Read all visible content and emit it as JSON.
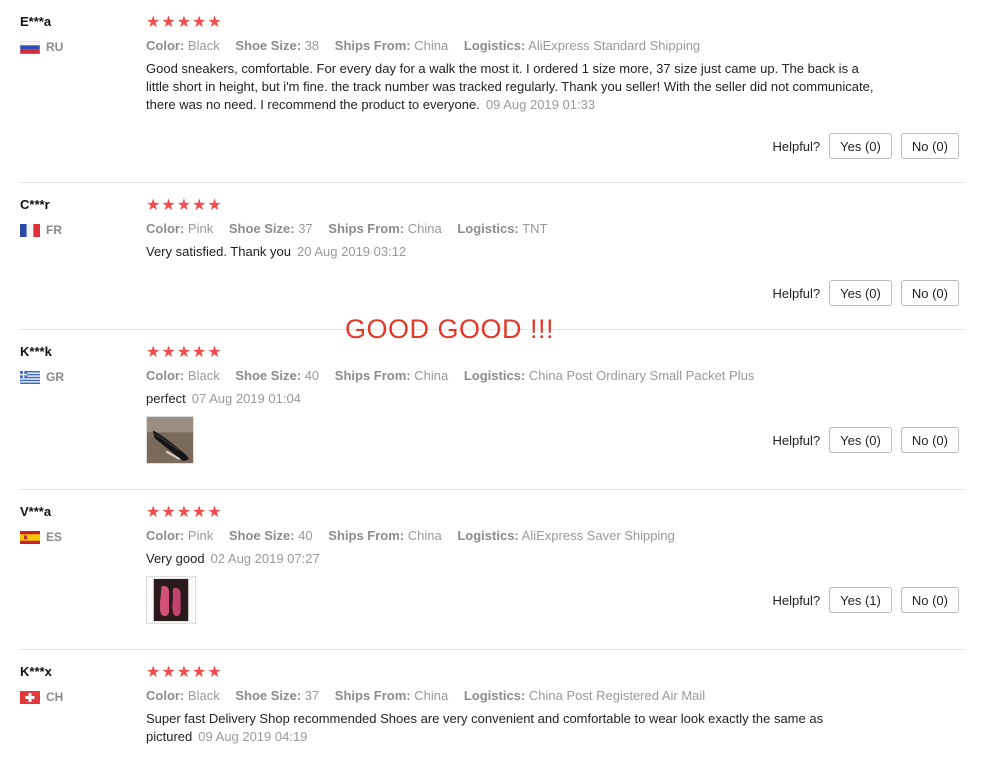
{
  "helpful_label": "Helpful?",
  "banner": "GOOD GOOD !!!",
  "colors": {
    "star": "#f04d4d",
    "banner": "#e23a2a",
    "meta": "#999999"
  },
  "reviews": [
    {
      "user": "E***a",
      "country": "RU",
      "stars": "★★★★★",
      "color_label": "Color:",
      "color": "Black",
      "size_label": "Shoe Size:",
      "size": "38",
      "ships_label": "Ships From:",
      "ships": "China",
      "logistics_label": "Logistics:",
      "logistics": "AliExpress Standard Shipping",
      "text": "Good sneakers, comfortable. For every day for a walk the most it. I ordered 1 size more, 37 size just came up. The back is a little short in height, but i'm fine. the track number was tracked regularly. Thank you seller! With the seller did not communicate, there was no need. I recommend the product to everyone.",
      "date": "09 Aug 2019 01:33",
      "yes": "Yes (0)",
      "no": "No (0)"
    },
    {
      "user": "C***r",
      "country": "FR",
      "stars": "★★★★★",
      "color_label": "Color:",
      "color": "Pink",
      "size_label": "Shoe Size:",
      "size": "37",
      "ships_label": "Ships From:",
      "ships": "China",
      "logistics_label": "Logistics:",
      "logistics": "TNT",
      "text": "Very satisfied. Thank you",
      "date": "20 Aug 2019 03:12",
      "yes": "Yes (0)",
      "no": "No (0)"
    },
    {
      "user": "K***k",
      "country": "GR",
      "stars": "★★★★★",
      "color_label": "Color:",
      "color": "Black",
      "size_label": "Shoe Size:",
      "size": "40",
      "ships_label": "Ships From:",
      "ships": "China",
      "logistics_label": "Logistics:",
      "logistics": "China Post Ordinary Small Packet Plus",
      "text": "perfect",
      "date": "07 Aug 2019 01:04",
      "yes": "Yes (0)",
      "no": "No (0)"
    },
    {
      "user": "V***a",
      "country": "ES",
      "stars": "★★★★★",
      "color_label": "Color:",
      "color": "Pink",
      "size_label": "Shoe Size:",
      "size": "40",
      "ships_label": "Ships From:",
      "ships": "China",
      "logistics_label": "Logistics:",
      "logistics": "AliExpress Saver Shipping",
      "text": "Very good",
      "date": "02 Aug 2019 07:27",
      "yes": "Yes (1)",
      "no": "No (0)"
    },
    {
      "user": "K***x",
      "country": "CH",
      "stars": "★★★★★",
      "color_label": "Color:",
      "color": "Black",
      "size_label": "Shoe Size:",
      "size": "37",
      "ships_label": "Ships From:",
      "ships": "China",
      "logistics_label": "Logistics:",
      "logistics": "China Post Registered Air Mail",
      "text": "Super fast Delivery Shop recommended Shoes are very convenient and comfortable to wear look exactly the same as pictured",
      "date": "09 Aug 2019 04:19"
    }
  ]
}
